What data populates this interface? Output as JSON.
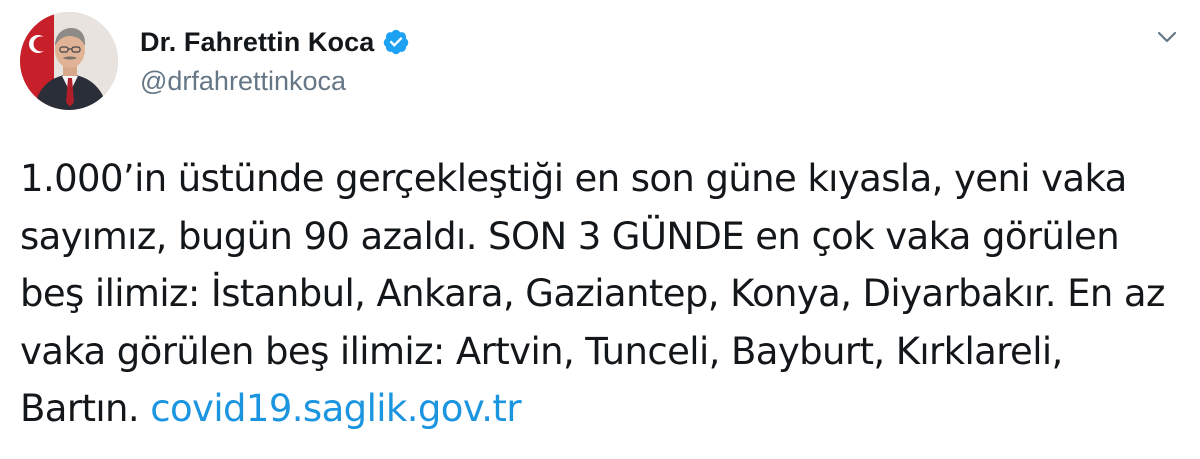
{
  "author": {
    "display_name": "Dr. Fahrettin Koca",
    "handle": "@drfahrettinkoca",
    "verified": true,
    "avatar_icon": "profile-photo",
    "verified_icon": "verified-badge-icon"
  },
  "tweet": {
    "text": "1.000’in üstünde gerçekleştiği en son güne kıyasla, yeni vaka sayımız, bugün 90 azaldı. SON 3 GÜNDE en çok vaka görülen beş ilimiz: İstanbul, Ankara, Gaziantep, Konya, Diyarbakır. En az vaka görülen beş ilimiz: Artvin, Tunceli, Bayburt, Kırklareli, Bartın.",
    "link_text": "covid19.saglik.gov.tr"
  },
  "menu": {
    "icon": "chevron-down-icon"
  },
  "colors": {
    "link": "#1b95e0",
    "verified": "#1da1f2",
    "handle": "#657786",
    "text": "#14171a"
  }
}
